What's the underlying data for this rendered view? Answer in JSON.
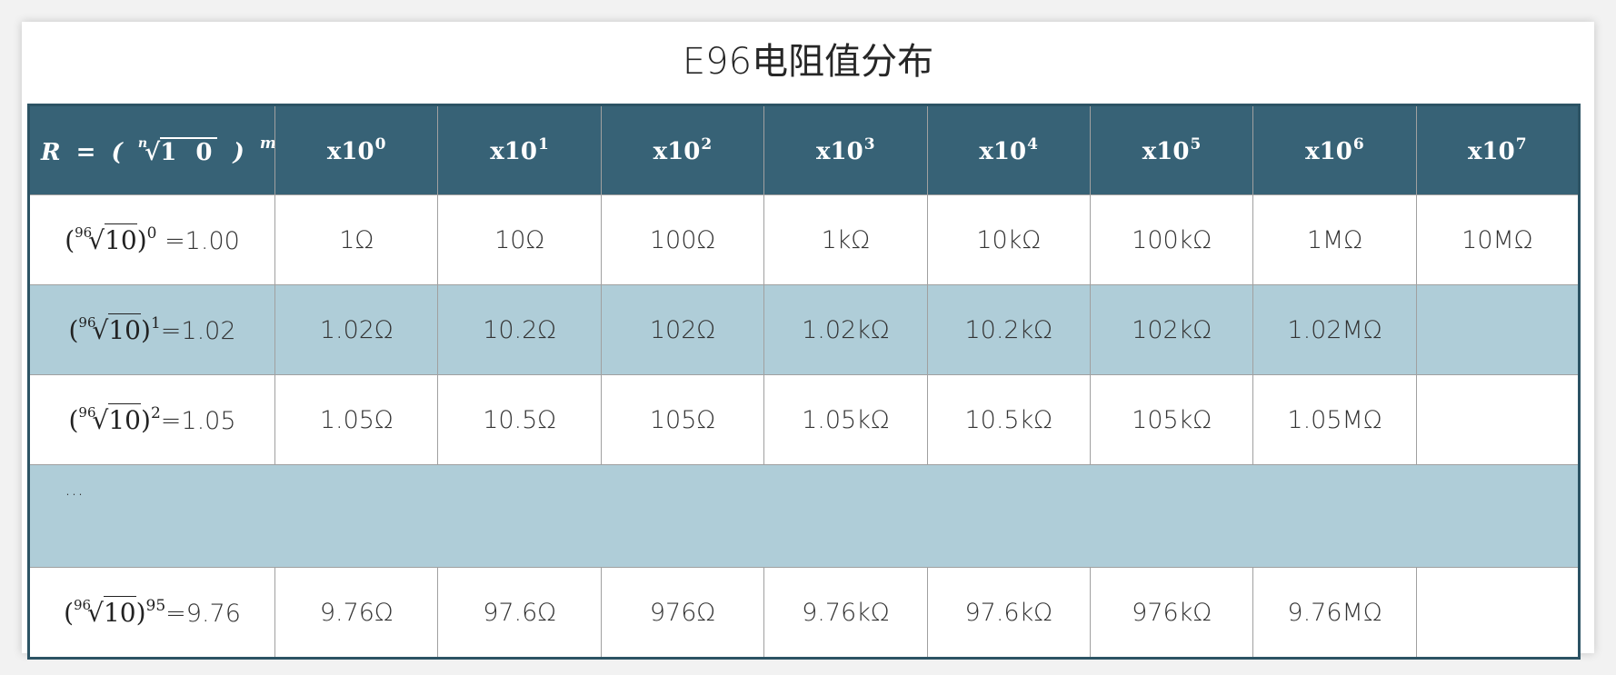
{
  "title": "E96电阻值分布",
  "header": {
    "formula": {
      "lhs": "R",
      "equals": "=",
      "open_paren": "(",
      "root_index": "n",
      "radical": "√",
      "radicand": "1 0",
      "close_paren": ")",
      "exponent": "m"
    },
    "columns": [
      {
        "base": "x10",
        "exp": "0"
      },
      {
        "base": "x10",
        "exp": "1"
      },
      {
        "base": "x10",
        "exp": "2"
      },
      {
        "base": "x10",
        "exp": "3"
      },
      {
        "base": "x10",
        "exp": "4"
      },
      {
        "base": "x10",
        "exp": "5"
      },
      {
        "base": "x10",
        "exp": "6"
      },
      {
        "base": "x10",
        "exp": "7"
      }
    ]
  },
  "rows": [
    {
      "root_index": "96",
      "radicand": "10",
      "exponent": "0",
      "result": "=1.00",
      "values": [
        "1Ω",
        "10Ω",
        "100Ω",
        "1kΩ",
        "10kΩ",
        "100kΩ",
        "1MΩ",
        "10MΩ"
      ]
    },
    {
      "root_index": "96",
      "radicand": "10",
      "exponent": "1",
      "result": "=1.02",
      "values": [
        "1.02Ω",
        "10.2Ω",
        "102Ω",
        "1.02kΩ",
        "10.2kΩ",
        "102kΩ",
        "1.02MΩ",
        ""
      ]
    },
    {
      "root_index": "96",
      "radicand": "10",
      "exponent": "2",
      "result": "=1.05",
      "values": [
        "1.05Ω",
        "10.5Ω",
        "105Ω",
        "1.05kΩ",
        "10.5kΩ",
        "105kΩ",
        "1.05MΩ",
        ""
      ]
    },
    {
      "root_index": "96",
      "radicand": "10",
      "exponent": "95",
      "result": "=9.76",
      "values": [
        "9.76Ω",
        "97.6Ω",
        "976Ω",
        "9.76kΩ",
        "97.6kΩ",
        "976kΩ",
        "9.76MΩ",
        ""
      ]
    }
  ],
  "ellipsis": "...",
  "colors": {
    "header_bg": "#376276",
    "band_bg": "#afcdd8",
    "border": "#2c5364"
  }
}
